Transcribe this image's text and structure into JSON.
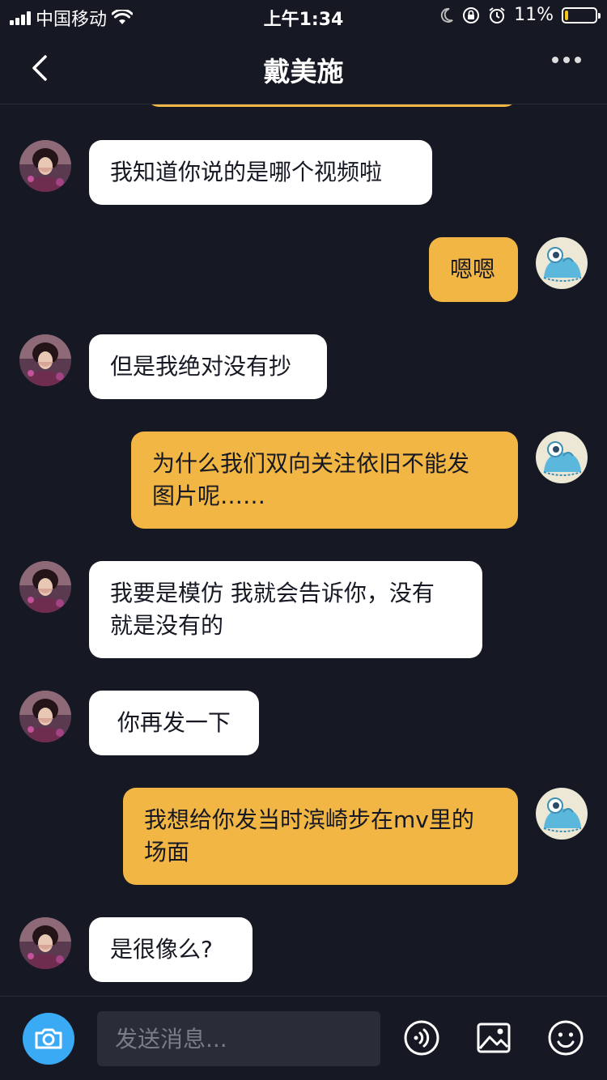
{
  "status_bar": {
    "carrier": "中国移动",
    "time": "上午1:34",
    "battery_percent": "11%",
    "battery_level": 0.11,
    "icons": [
      "signal-icon",
      "wifi-icon",
      "moon-icon",
      "rotation-lock-icon",
      "alarm-icon",
      "battery-icon"
    ]
  },
  "header": {
    "title": "戴美施",
    "back_icon": "chevron-left-icon",
    "more_icon": "more-dots-icon"
  },
  "messages": [
    {
      "sender": "them",
      "text": "我知道你说的是哪个视频啦"
    },
    {
      "sender": "me",
      "text": "嗯嗯"
    },
    {
      "sender": "them",
      "text": "但是我绝对没有抄"
    },
    {
      "sender": "me",
      "text": "为什么我们双向关注依旧不能发\n图片呢……"
    },
    {
      "sender": "them",
      "text": "我要是模仿 我就会告诉你，没有\n就是没有的"
    },
    {
      "sender": "them",
      "text": " 你再发一下"
    },
    {
      "sender": "me",
      "text": "我想给你发当时滨崎步在mv里的\n场面"
    },
    {
      "sender": "them",
      "text": "是很像么?"
    }
  ],
  "input_bar": {
    "placeholder": "发送消息...",
    "icons": [
      "camera-icon",
      "voice-icon",
      "image-icon",
      "emoji-icon"
    ]
  },
  "colors": {
    "background": "#161823",
    "my_bubble": "#f1b643",
    "their_bubble": "#ffffff",
    "camera_button": "#3aaaf5",
    "input_background": "#2a2c38"
  }
}
